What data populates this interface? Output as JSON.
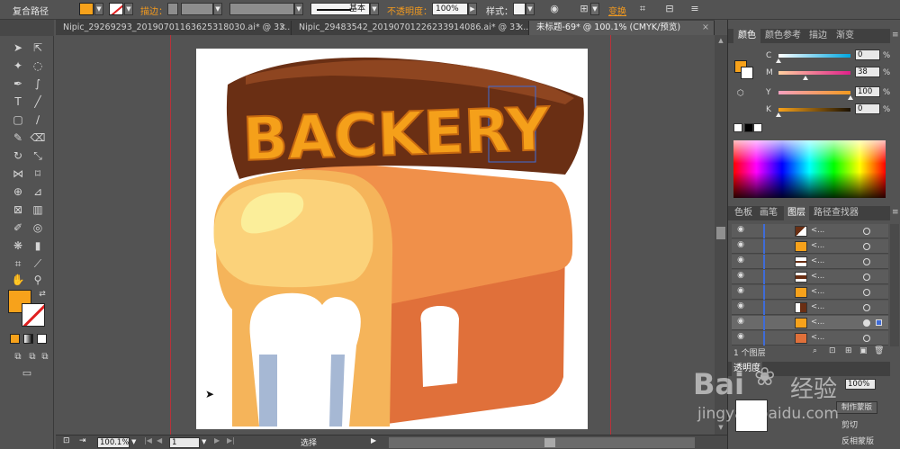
{
  "control_bar": {
    "selection_label": "复合路径",
    "stroke_label": "描边：",
    "stroke_style": "基本",
    "opacity_label": "不透明度：",
    "opacity_value": "100%",
    "style_label": "样式：",
    "transform_label": "变换",
    "fill_color": "#f7a21b"
  },
  "document_tabs": [
    {
      "label": "Nipic_29269293_20190701163625318030.ai* @ 33..."
    },
    {
      "label": "Nipic_29483542_20190701226233914086.ai* @ 33..."
    },
    {
      "label": "未标题-69* @ 100.1% (CMYK/预览)"
    }
  ],
  "status_bar": {
    "zoom": "100.1%",
    "artboard_number": "1",
    "tool_name": "选择"
  },
  "color_panel": {
    "tabs": [
      "颜色",
      "颜色参考",
      "描边",
      "渐变"
    ],
    "channels": [
      {
        "name": "C",
        "value": "0",
        "unit": "%"
      },
      {
        "name": "M",
        "value": "38",
        "unit": "%"
      },
      {
        "name": "Y",
        "value": "100",
        "unit": "%"
      },
      {
        "name": "K",
        "value": "0",
        "unit": "%"
      }
    ]
  },
  "layers_panel": {
    "tabs": [
      "色板",
      "画笔",
      "图层",
      "路径查找器"
    ],
    "active_tab": "图层",
    "rows": [
      {
        "name": "<..."
      },
      {
        "name": "<..."
      },
      {
        "name": "<..."
      },
      {
        "name": "<..."
      },
      {
        "name": "<..."
      },
      {
        "name": "<..."
      },
      {
        "name": "<..."
      },
      {
        "name": "<..."
      }
    ],
    "layer_count": "1 个图层"
  },
  "transparency_panel": {
    "title": "透明度",
    "opacity": "100%",
    "make_mask_button": "制作蒙版",
    "clip_label": "剪切",
    "invert_mask_label": "反相蒙版"
  },
  "artwork": {
    "sign_text": "BACKERY"
  },
  "watermark": {
    "brand": "Bai",
    "brand_cn": "经验",
    "url": "jingyan.baidu.com"
  }
}
